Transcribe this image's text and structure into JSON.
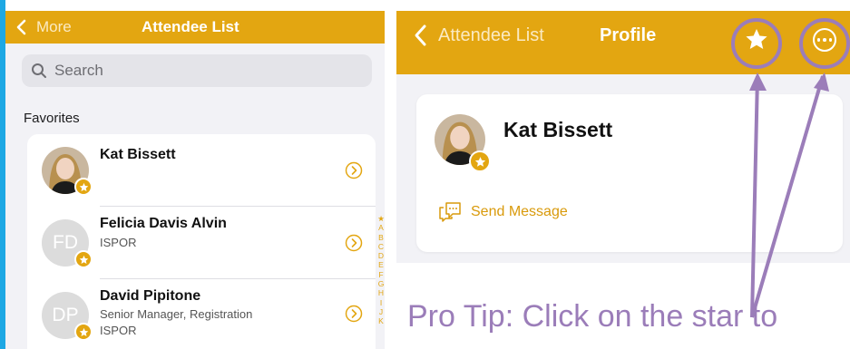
{
  "left": {
    "nav": {
      "back_label": "More",
      "title": "Attendee List"
    },
    "search": {
      "placeholder": "Search"
    },
    "section_header": "Favorites",
    "attendees": [
      {
        "name": "Kat Bissett",
        "title": "",
        "org": "",
        "initials": "",
        "has_photo": true,
        "favorite": true
      },
      {
        "name": "Felicia Davis Alvin",
        "title": "",
        "org": "ISPOR",
        "initials": "FD",
        "has_photo": false,
        "favorite": true
      },
      {
        "name": "David Pipitone",
        "title": "Senior Manager, Registration",
        "org": "ISPOR",
        "initials": "DP",
        "has_photo": false,
        "favorite": true
      }
    ],
    "alpha_index": [
      "★",
      "A",
      "B",
      "C",
      "D",
      "E",
      "F",
      "G",
      "H",
      "I",
      "J",
      "K"
    ]
  },
  "right": {
    "nav": {
      "back_label": "Attendee List",
      "title": "Profile",
      "star_icon": "star-icon",
      "more_icon": "more-icon"
    },
    "profile": {
      "name": "Kat Bissett",
      "action_label": "Send Message"
    },
    "tip_text": "Pro Tip: Click on the star to"
  },
  "colors": {
    "accent": "#e3a611",
    "annotation": "#9b7db9",
    "edge": "#1ea8e4"
  }
}
